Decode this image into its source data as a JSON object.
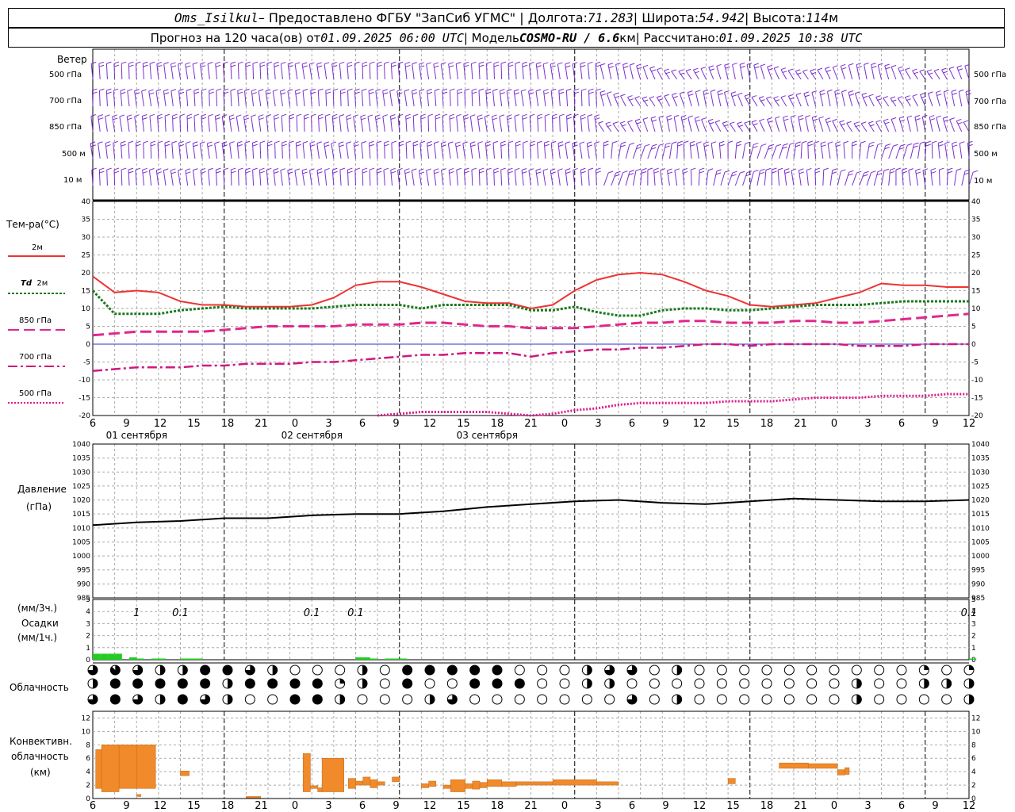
{
  "header": {
    "line1": {
      "station": "Oms_Isilkul",
      "provider": " – Предоставлено ФГБУ \"ЗапСиб УГМС\" | Долгота: ",
      "lon": "71.283",
      "lat_label": " | Широта: ",
      "lat": "54.942",
      "alt_label": " | Высота: ",
      "alt": "114",
      "alt_unit": "м"
    },
    "line2": {
      "forecast": "Прогноз на 120 часа(ов) от ",
      "start": "01.09.2025 06:00 UTC",
      "model_label": " | Модель ",
      "model": "COSMO-RU / 6.6",
      "model_unit": "км",
      "calc_label": " | Рассчитано: ",
      "calc": "01.09.2025 10:38 UTC"
    }
  },
  "panel_labels": {
    "wind": "Ветер",
    "wind_levels": [
      "500 гПа",
      "700 гПа",
      "850 гПа",
      "500 м",
      "10 м"
    ],
    "temperature": "Тем-ра(°C)",
    "t2m": "2м",
    "td": "Td",
    "td_level": "2м",
    "t850": "850 гПа",
    "t700": "700 гПа",
    "t500": "500 гПа",
    "pressure": "Давление",
    "pressure_unit": "(гПа)",
    "precip_unit_3h": "(мм/3ч.)",
    "precip": "Осадки",
    "precip_unit_1h": "(мм/1ч.)",
    "cloudiness": "Облачность",
    "convective_1": "Конвективн.",
    "convective_2": "облачность",
    "convective_unit": "(км)"
  },
  "colors": {
    "wind": "#7b2fd0",
    "t2m": "#ee3333",
    "td": "#1a7a1a",
    "t850": "#e0288c",
    "t700": "#d0187c",
    "t500": "#e0188c",
    "pressure": "#000000",
    "precip": "#22cc22",
    "convective": "#f08a2a",
    "zero_line": "#3333cc",
    "grid": "#aaaaaa"
  },
  "x_axis": {
    "hour_ticks": [
      "6",
      "9",
      "12",
      "15",
      "18",
      "21",
      "0",
      "3",
      "6",
      "9",
      "12",
      "15",
      "18",
      "21",
      "0",
      "3",
      "6",
      "9",
      "12",
      "15",
      "18",
      "21",
      "0",
      "3",
      "6",
      "9",
      "12"
    ],
    "dates": [
      "01 сентября",
      "02 сентября",
      "03 сентября"
    ]
  },
  "chart_data": [
    {
      "type": "barbs",
      "title": "Ветер",
      "levels": [
        "500 гПа",
        "700 гПа",
        "850 гПа",
        "500 м",
        "10 м"
      ]
    },
    {
      "type": "line",
      "title": "Тем-ра(°C)",
      "xlabel": "hours from 01.09.2025 06:00 UTC",
      "ylim": [
        -20,
        40
      ],
      "yticks": [
        "40",
        "35",
        "30",
        "25",
        "20",
        "15",
        "10",
        "5",
        "0",
        "-5",
        "-10",
        "-15",
        "-20"
      ],
      "x": [
        0,
        3,
        6,
        9,
        12,
        15,
        18,
        21,
        24,
        27,
        30,
        33,
        36,
        39,
        42,
        45,
        48,
        51,
        54,
        57,
        60,
        63,
        66,
        69,
        72,
        75,
        78,
        81,
        84,
        87,
        90,
        93,
        96,
        99,
        102,
        105,
        108,
        111,
        114,
        117,
        120
      ],
      "series": [
        {
          "name": "2м",
          "values": [
            19,
            14.5,
            15,
            14.5,
            12,
            11,
            11,
            10.5,
            10.5,
            10.5,
            11,
            13,
            16.5,
            17.5,
            17.5,
            16,
            14,
            12,
            11.5,
            11.5,
            10,
            11,
            15,
            18,
            19.5,
            20,
            19.5,
            17.5,
            15,
            13.5,
            11,
            10.5,
            11,
            11.5,
            13,
            14.5,
            17,
            16.5,
            16.5,
            16,
            16
          ]
        },
        {
          "name": "Td 2м",
          "values": [
            15,
            8.5,
            8.5,
            8.5,
            9.5,
            10,
            10.5,
            10,
            10,
            10,
            10,
            10.5,
            11,
            11,
            11,
            10,
            11,
            11,
            11,
            11,
            9.5,
            9.5,
            10.5,
            9,
            8,
            8,
            9.5,
            10,
            10,
            9.5,
            9.5,
            10,
            10.5,
            11,
            11,
            11,
            11.5,
            12,
            12,
            12,
            12
          ]
        },
        {
          "name": "850 гПа",
          "values": [
            2.5,
            3,
            3.5,
            3.5,
            3.5,
            3.5,
            4,
            4.5,
            5,
            5,
            5,
            5,
            5.5,
            5.5,
            5.5,
            6,
            6,
            5.5,
            5,
            5,
            4.5,
            4.5,
            4.5,
            5,
            5.5,
            6,
            6,
            6.5,
            6.5,
            6,
            6,
            6,
            6.5,
            6.5,
            6,
            6,
            6.5,
            7,
            7.5,
            8,
            8.5
          ]
        },
        {
          "name": "700 гПа",
          "values": [
            -7.5,
            -7,
            -6.5,
            -6.5,
            -6.5,
            -6,
            -6,
            -5.5,
            -5.5,
            -5.5,
            -5,
            -5,
            -4.5,
            -4,
            -3.5,
            -3,
            -3,
            -2.5,
            -2.5,
            -2.5,
            -3.5,
            -2.5,
            -2,
            -1.5,
            -1.5,
            -1,
            -1,
            -0.5,
            0,
            0,
            -0.5,
            0,
            0,
            0,
            0,
            -0.5,
            -0.5,
            -0.5,
            0,
            0,
            0
          ]
        },
        {
          "name": "500 гПа",
          "values": [
            null,
            null,
            null,
            null,
            null,
            null,
            null,
            null,
            null,
            null,
            null,
            null,
            null,
            -20,
            -19.5,
            -19,
            -19,
            -19,
            -19,
            -19.5,
            -20,
            -19.5,
            -18.5,
            -18,
            -17,
            -16.5,
            -16.5,
            -16.5,
            -16.5,
            -16,
            -16,
            -16,
            -15.5,
            -15,
            -15,
            -15,
            -14.5,
            -14.5,
            -14.5,
            -14,
            -14
          ]
        }
      ]
    },
    {
      "type": "line",
      "title": "Давление",
      "ylabel": "(гПа)",
      "ylim": [
        985,
        1040
      ],
      "yticks": [
        "1040",
        "1035",
        "1030",
        "1025",
        "1020",
        "1015",
        "1010",
        "1005",
        "1000",
        "995",
        "990",
        "985"
      ],
      "x": [
        0,
        6,
        12,
        18,
        24,
        30,
        36,
        42,
        48,
        54,
        60,
        66,
        72,
        78,
        84,
        90,
        96,
        102,
        108,
        114,
        120
      ],
      "series": [
        {
          "name": "Давление",
          "values": [
            1011,
            1012,
            1012.5,
            1013.5,
            1013.5,
            1014.5,
            1015,
            1015,
            1016,
            1017.5,
            1018.5,
            1019.5,
            1020,
            1019,
            1018.5,
            1019.5,
            1020.5,
            1020,
            1019.5,
            1019.5,
            1020
          ]
        }
      ]
    },
    {
      "type": "bar",
      "title": "Осадки",
      "ylim": [
        0,
        5
      ],
      "yticks": [
        "5",
        "4",
        "3",
        "2",
        "1",
        "0"
      ],
      "annotations": [
        {
          "x": 6,
          "text": "1"
        },
        {
          "x": 12,
          "text": "0.1"
        },
        {
          "x": 30,
          "text": "0.1"
        },
        {
          "x": 36,
          "text": "0.1"
        },
        {
          "x": 120,
          "text": "0.1"
        }
      ],
      "x": [
        0,
        1,
        2,
        3,
        5,
        6,
        8,
        9,
        12,
        13,
        14,
        36,
        37,
        38,
        40,
        41,
        42,
        120
      ],
      "values": [
        0.5,
        0.5,
        0.5,
        0.5,
        0.2,
        0.1,
        0.1,
        0.1,
        0.1,
        0.1,
        0.1,
        0.2,
        0.2,
        0.1,
        0.1,
        0.1,
        0.1,
        0.1
      ]
    },
    {
      "type": "table",
      "title": "Облачность",
      "rows": 3,
      "columns": 40,
      "cover_oktas": [
        [
          6,
          7,
          6,
          4,
          4,
          8,
          8,
          6,
          4,
          0,
          0,
          0,
          4,
          0,
          8,
          8,
          8,
          8,
          8,
          0,
          0,
          0,
          4,
          6,
          6,
          0,
          4,
          0,
          0,
          0,
          0,
          0,
          0,
          0,
          0,
          0,
          0,
          2,
          0,
          2
        ],
        [
          4,
          8,
          8,
          8,
          8,
          8,
          4,
          8,
          8,
          8,
          8,
          2,
          4,
          0,
          8,
          0,
          0,
          8,
          8,
          8,
          0,
          0,
          4,
          4,
          0,
          0,
          0,
          0,
          0,
          0,
          0,
          0,
          0,
          0,
          4,
          0,
          0,
          4,
          4,
          4
        ],
        [
          6,
          8,
          6,
          4,
          8,
          6,
          4,
          0,
          0,
          8,
          8,
          4,
          0,
          0,
          0,
          4,
          6,
          0,
          0,
          0,
          0,
          0,
          0,
          0,
          6,
          0,
          4,
          0,
          0,
          0,
          0,
          0,
          0,
          0,
          4,
          0,
          0,
          0,
          0,
          4
        ]
      ]
    },
    {
      "type": "bar",
      "title": "Конвективн. облачность",
      "ylabel": "(км)",
      "ylim": [
        0,
        13
      ],
      "yticks": [
        "12",
        "10",
        "8",
        "6",
        "4",
        "2",
        "0"
      ],
      "bars": [
        {
          "x0": 0.4,
          "x1": 1.2,
          "bottom": 1.5,
          "top": 7.3
        },
        {
          "x0": 1.2,
          "x1": 3.6,
          "bottom": 1.0,
          "top": 8.0
        },
        {
          "x0": 3.6,
          "x1": 6.0,
          "bottom": 1.5,
          "top": 8.0
        },
        {
          "x0": 6.0,
          "x1": 8.6,
          "bottom": 1.5,
          "top": 8.0
        },
        {
          "x0": 6.0,
          "x1": 6.6,
          "bottom": 0.3,
          "top": 0.6
        },
        {
          "x0": 12.0,
          "x1": 13.2,
          "bottom": 3.4,
          "top": 4.1
        },
        {
          "x0": 21.0,
          "x1": 23.0,
          "bottom": 0.1,
          "top": 0.3
        },
        {
          "x0": 28.8,
          "x1": 29.8,
          "bottom": 1.0,
          "top": 6.7
        },
        {
          "x0": 29.8,
          "x1": 30.8,
          "bottom": 1.5,
          "top": 1.9
        },
        {
          "x0": 30.8,
          "x1": 31.4,
          "bottom": 1.0,
          "top": 1.6
        },
        {
          "x0": 31.4,
          "x1": 34.4,
          "bottom": 1.0,
          "top": 6.0
        },
        {
          "x0": 35.0,
          "x1": 36.0,
          "bottom": 1.5,
          "top": 3.0
        },
        {
          "x0": 36.0,
          "x1": 37.0,
          "bottom": 2.0,
          "top": 2.6
        },
        {
          "x0": 37.0,
          "x1": 38.0,
          "bottom": 2.0,
          "top": 3.2
        },
        {
          "x0": 38.0,
          "x1": 39.0,
          "bottom": 1.6,
          "top": 2.8
        },
        {
          "x0": 39.0,
          "x1": 40.0,
          "bottom": 2.0,
          "top": 2.5
        },
        {
          "x0": 41.0,
          "x1": 42.0,
          "bottom": 2.5,
          "top": 3.2
        },
        {
          "x0": 45.0,
          "x1": 46.0,
          "bottom": 1.6,
          "top": 2.2
        },
        {
          "x0": 46.0,
          "x1": 47.0,
          "bottom": 1.8,
          "top": 2.6
        },
        {
          "x0": 48.0,
          "x1": 49.0,
          "bottom": 1.5,
          "top": 2.0
        },
        {
          "x0": 49.0,
          "x1": 51.0,
          "bottom": 1.0,
          "top": 2.8
        },
        {
          "x0": 51.0,
          "x1": 52.0,
          "bottom": 1.5,
          "top": 2.2
        },
        {
          "x0": 52.0,
          "x1": 53.0,
          "bottom": 1.4,
          "top": 2.6
        },
        {
          "x0": 53.0,
          "x1": 54.0,
          "bottom": 1.6,
          "top": 2.4
        },
        {
          "x0": 54.0,
          "x1": 56.0,
          "bottom": 1.8,
          "top": 2.8
        },
        {
          "x0": 56.0,
          "x1": 58.0,
          "bottom": 1.8,
          "top": 2.5
        },
        {
          "x0": 58.0,
          "x1": 63.0,
          "bottom": 2.0,
          "top": 2.5
        },
        {
          "x0": 63.0,
          "x1": 69.0,
          "bottom": 2.0,
          "top": 2.8
        },
        {
          "x0": 69.0,
          "x1": 72.0,
          "bottom": 2.0,
          "top": 2.5
        },
        {
          "x0": 87.0,
          "x1": 88.0,
          "bottom": 2.2,
          "top": 3.0
        },
        {
          "x0": 94.0,
          "x1": 98.0,
          "bottom": 4.5,
          "top": 5.3
        },
        {
          "x0": 98.0,
          "x1": 102.0,
          "bottom": 4.5,
          "top": 5.2
        },
        {
          "x0": 102.0,
          "x1": 103.0,
          "bottom": 3.5,
          "top": 4.3
        },
        {
          "x0": 103.0,
          "x1": 103.6,
          "bottom": 3.6,
          "top": 4.6
        }
      ]
    }
  ]
}
